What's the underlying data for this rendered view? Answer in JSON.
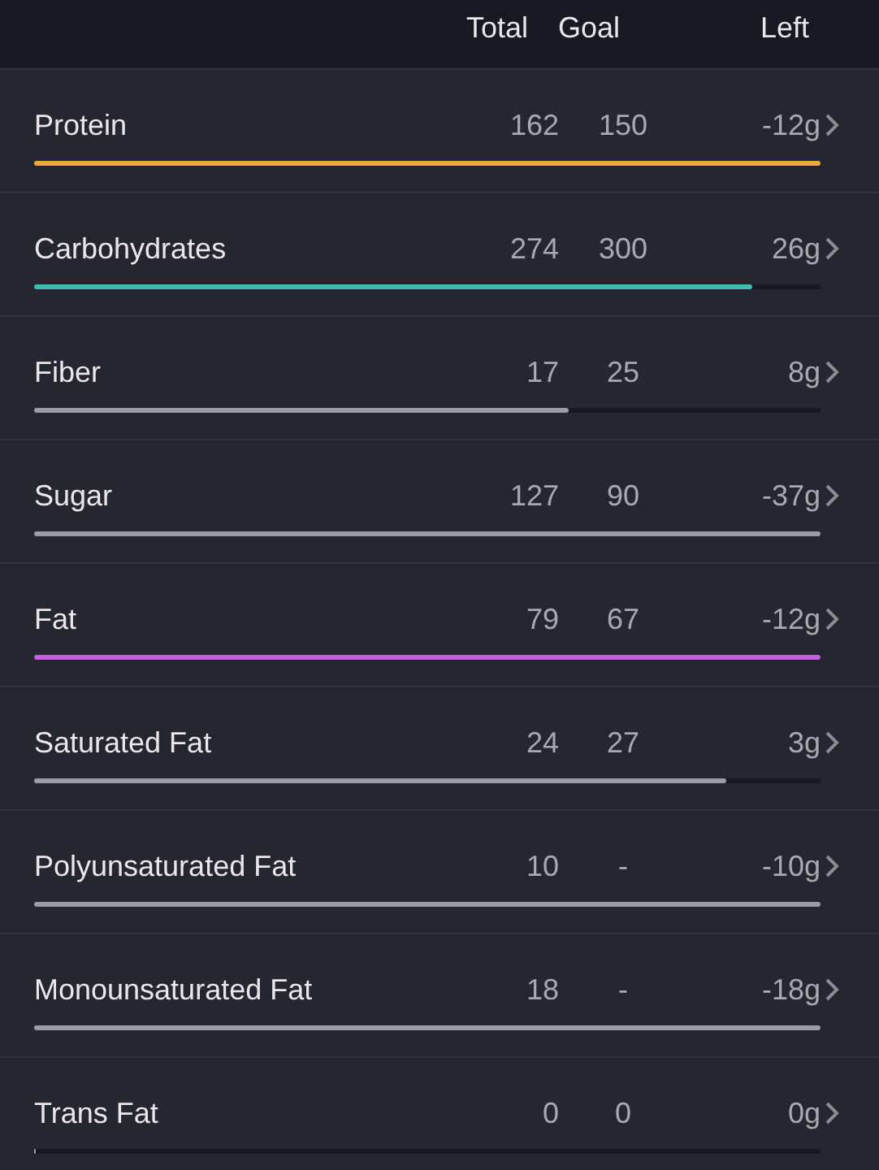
{
  "header": {
    "columns": [
      "Total",
      "Goal",
      "Left"
    ]
  },
  "nutrients": [
    {
      "name": "Protein",
      "total": "162",
      "goal": "150",
      "left": "-12g",
      "level": 1,
      "color": "#f0a73a"
    },
    {
      "name": "Carbohydrates",
      "total": "274",
      "goal": "300",
      "left": "26g",
      "level": 0.913,
      "color": "#3bbfb0"
    },
    {
      "name": "Fiber",
      "total": "17",
      "goal": "25",
      "left": "8g",
      "level": 0.68,
      "color": "#9a9ba3"
    },
    {
      "name": "Sugar",
      "total": "127",
      "goal": "90",
      "left": "-37g",
      "level": 1,
      "color": "#9a9ba3"
    },
    {
      "name": "Fat",
      "total": "79",
      "goal": "67",
      "left": "-12g",
      "level": 1,
      "color": "#c55fe0"
    },
    {
      "name": "Saturated Fat",
      "total": "24",
      "goal": "27",
      "left": "3g",
      "level": 0.88,
      "color": "#9a9ba3"
    },
    {
      "name": "Polyunsaturated Fat",
      "total": "10",
      "goal": "-",
      "left": "-10g",
      "level": 1,
      "color": "#9a9ba3"
    },
    {
      "name": "Monounsaturated Fat",
      "total": "18",
      "goal": "-",
      "left": "-18g",
      "level": 1,
      "color": "#9a9ba3"
    },
    {
      "name": "Trans Fat",
      "total": "0",
      "goal": "0",
      "left": "0g",
      "level": 0,
      "color": "#9a9ba3"
    }
  ]
}
